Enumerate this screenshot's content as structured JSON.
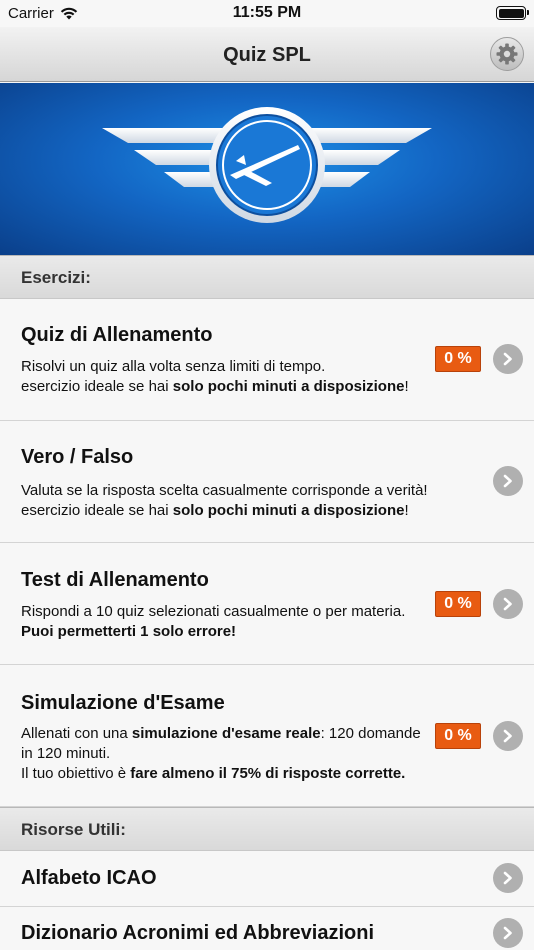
{
  "status": {
    "carrier": "Carrier",
    "time": "11:55 PM"
  },
  "nav": {
    "title": "Quiz SPL"
  },
  "sections": {
    "esercizi": "Esercizi:",
    "risorse": "Risorse Utili:"
  },
  "rows": [
    {
      "title": "Quiz di Allenamento",
      "line1_a": "Risolvi un quiz alla volta senza limiti di tempo.",
      "line2_a": "esercizio ideale se hai ",
      "line2_b": "solo pochi minuti a disposizione",
      "line2_c": "!",
      "badge": "0 %"
    },
    {
      "title": "Vero / Falso",
      "line1_a": "Valuta se la risposta scelta casualmente corrisponde a verità!",
      "line2_a": "esercizio ideale se hai ",
      "line2_b": "solo pochi minuti a disposizione",
      "line2_c": "!"
    },
    {
      "title": "Test di Allenamento",
      "line1_a": "Rispondi a 10 quiz selezionati casualmente o per materia.",
      "line2_b": "Puoi permetterti 1 solo errore!",
      "badge": "0 %"
    },
    {
      "title": "Simulazione d'Esame",
      "line1_a": "Allenati con una ",
      "line1_b": "simulazione d'esame reale",
      "line1_c": ": 120 domande",
      "line2_a": "in 120 minuti.",
      "line3_a": "Il tuo obiettivo è ",
      "line3_b": "fare almeno il 75% di risposte corrette.",
      "badge": "0 %"
    }
  ],
  "resources": [
    {
      "title": "Alfabeto ICAO"
    },
    {
      "title": "Dizionario Acronimi ed Abbreviazioni"
    }
  ],
  "colors": {
    "badge": "#e85b12",
    "banner": "#1366c4",
    "chevron": "#b0b0b0"
  },
  "icons": {
    "settings": "gear-icon",
    "row_arrow": "chevron-right-icon",
    "banner": "glider-wings-logo"
  }
}
